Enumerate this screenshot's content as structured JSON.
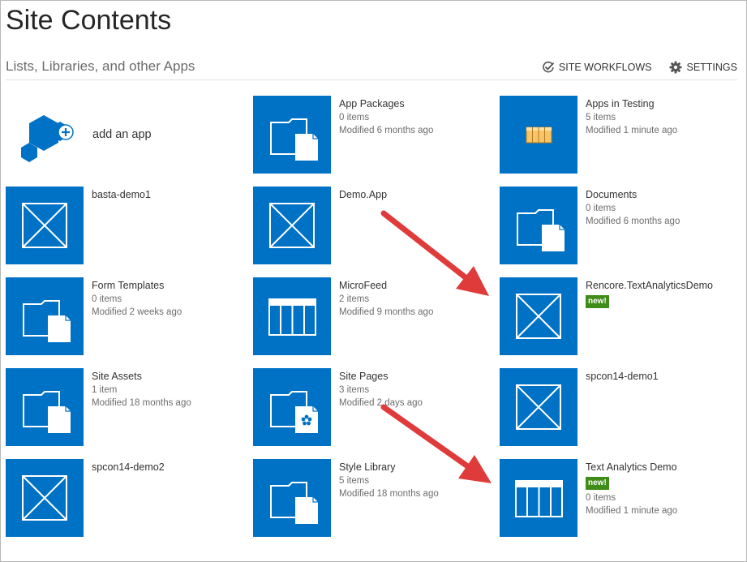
{
  "page": {
    "title": "Site Contents",
    "subtitle": "Lists, Libraries, and other Apps"
  },
  "toolbar": {
    "site_workflows": "SITE WORKFLOWS",
    "settings": "SETTINGS"
  },
  "add_app": {
    "label": "add an app"
  },
  "colors": {
    "tile": "#0072c6",
    "badge": "#3f8c18",
    "arrow": "#e03b3b"
  },
  "apps": [
    {
      "name": "App Packages",
      "items": "0 items",
      "modified": "Modified 6 months ago",
      "icon": "document-library-icon"
    },
    {
      "name": "Apps in Testing",
      "items": "5 items",
      "modified": "Modified 1 minute ago",
      "icon": "list-icon-small"
    },
    {
      "name": "basta-demo1",
      "icon": "app-placeholder-icon"
    },
    {
      "name": "Demo.App",
      "icon": "app-placeholder-icon"
    },
    {
      "name": "Documents",
      "items": "0 items",
      "modified": "Modified 6 months ago",
      "icon": "document-library-icon"
    },
    {
      "name": "Form Templates",
      "items": "0 items",
      "modified": "Modified 2 weeks ago",
      "icon": "document-library-icon"
    },
    {
      "name": "MicroFeed",
      "items": "2 items",
      "modified": "Modified 9 months ago",
      "icon": "list-icon"
    },
    {
      "name": "Rencore.TextAnalyticsDemo",
      "badge": "new!",
      "icon": "app-placeholder-icon"
    },
    {
      "name": "Site Assets",
      "items": "1 item",
      "modified": "Modified 18 months ago",
      "icon": "document-library-icon"
    },
    {
      "name": "Site Pages",
      "items": "3 items",
      "modified": "Modified 2 days ago",
      "icon": "wiki-page-library-icon"
    },
    {
      "name": "spcon14-demo1",
      "icon": "app-placeholder-icon"
    },
    {
      "name": "spcon14-demo2",
      "icon": "app-placeholder-icon"
    },
    {
      "name": "Style Library",
      "items": "5 items",
      "modified": "Modified 18 months ago",
      "icon": "document-library-icon"
    },
    {
      "name": "Text Analytics Demo",
      "badge": "new!",
      "items": "0 items",
      "modified": "Modified 1 minute ago",
      "icon": "list-icon"
    }
  ]
}
